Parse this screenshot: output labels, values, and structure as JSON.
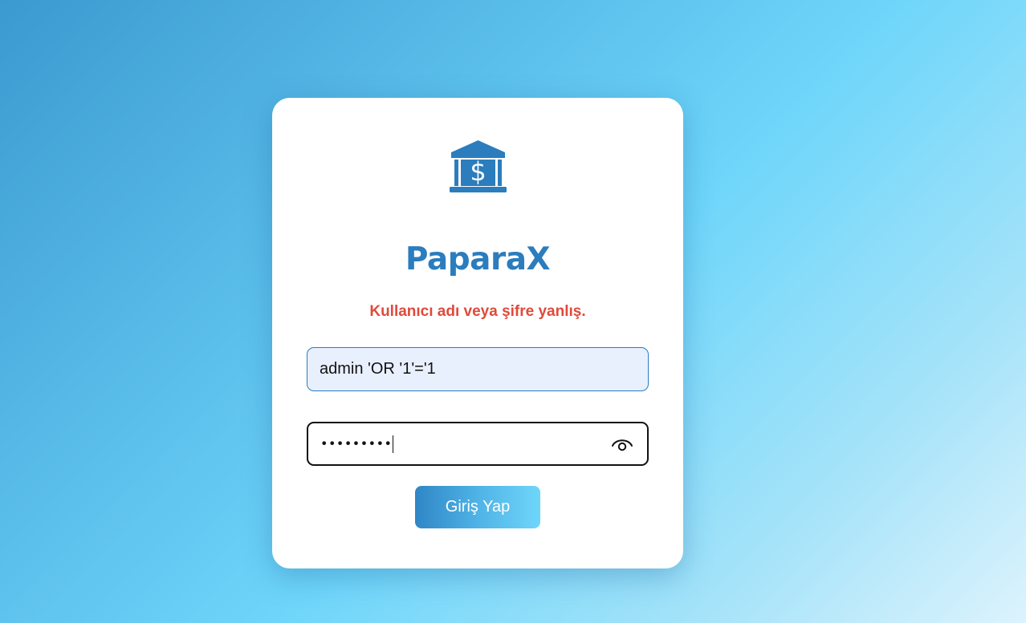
{
  "brand": {
    "name": "PaparaX",
    "logo_icon": "bank-dollar-icon",
    "color": "#2b7dbd"
  },
  "error": {
    "message": "Kullanıcı adı veya şifre yanlış.",
    "color": "#e04a3a"
  },
  "form": {
    "username_value": "admin 'OR '1'='1",
    "password_masked": "•••••••••",
    "password_toggle_icon": "eye-icon",
    "submit_label": "Giriş Yap"
  }
}
